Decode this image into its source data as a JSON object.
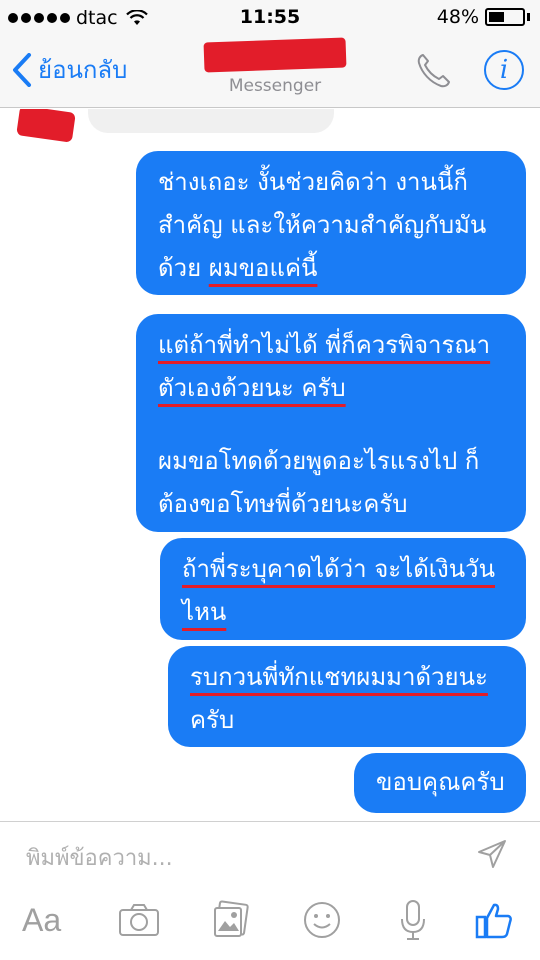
{
  "status": {
    "carrier": "dtac",
    "time": "11:55",
    "battery": "48%",
    "battery_level": 0.48
  },
  "nav": {
    "back_label": "ย้อนกลับ",
    "subtitle": "Messenger"
  },
  "messages": [
    {
      "lines": [
        {
          "t": "ช่างเถอะ งั้นช่วยคิดว่า งานนี้ก็",
          "u": false
        },
        {
          "t": "สำคัญ และให้ความสำคัญกับมัน",
          "u": false
        },
        {
          "t": "ด้วย ",
          "u": false,
          "t2": "ผมขอแค่นี้"
        }
      ]
    },
    {
      "lines": [
        {
          "t": "แต่ถ้าพี่ทำไม่ได้ พี่ก็ควรพิจารณา"
        },
        {
          "t": "ตัวเองด้วยนะ ครับ"
        },
        {
          "t": "ผมขอโทดด้วยพูดอะไรแรงไป ก็"
        },
        {
          "t": "ต้องขอโทษพี่ด้วยนะครับ"
        }
      ]
    },
    {
      "lines": [
        {
          "t": "ถ้าพี่ระบุคาดได้ว่า จะได้เงินวัน"
        },
        {
          "t": "ไหน"
        }
      ]
    },
    {
      "lines": [
        {
          "t": "รบกวนพี่ทักแชทผมมาด้วยนะ"
        },
        {
          "t": "ครับ"
        }
      ]
    },
    {
      "lines": [
        {
          "t": "ขอบคุณครับ"
        }
      ]
    }
  ],
  "composer": {
    "placeholder": "พิมพ์ข้อความ...",
    "aa_label": "Aa"
  },
  "icons": {
    "accent": "#1a7cf5",
    "bubble": "#1a7cf5",
    "redaction": "#e21d2a"
  }
}
